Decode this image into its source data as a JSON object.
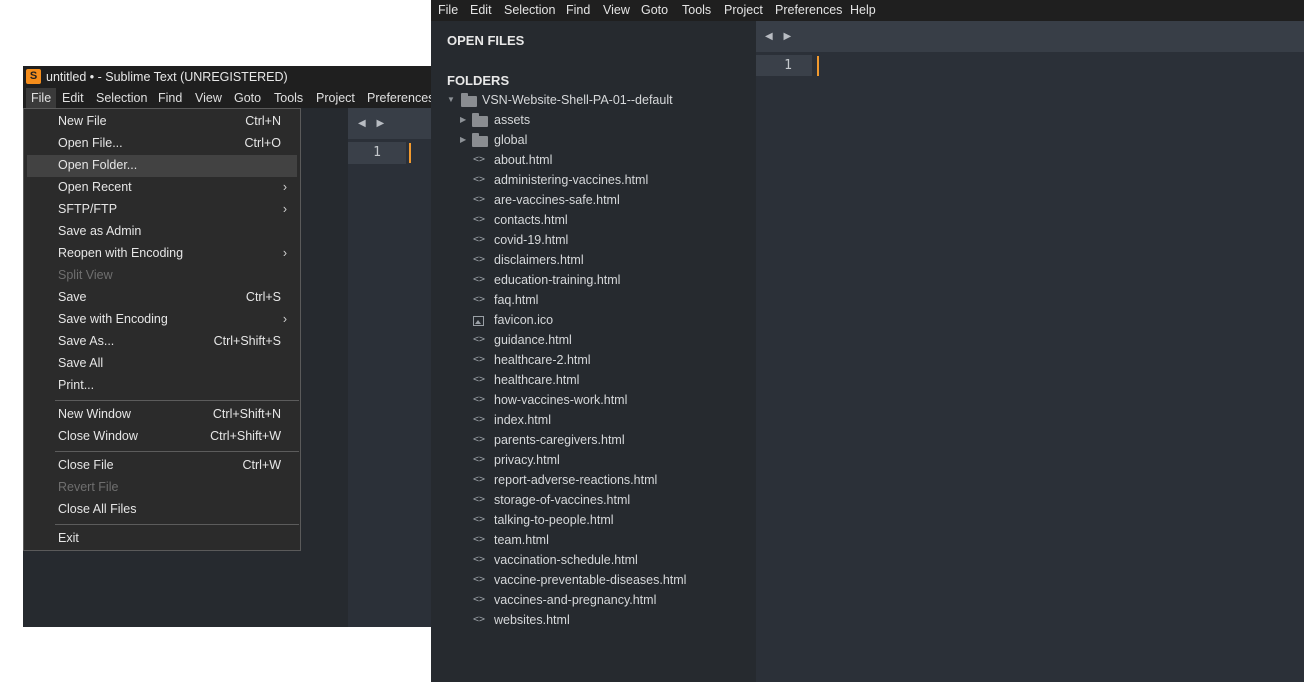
{
  "window1": {
    "title": "untitled • - Sublime Text (UNREGISTERED)",
    "logo": "S",
    "menu": [
      "File",
      "Edit",
      "Selection",
      "Find",
      "View",
      "Goto",
      "Tools",
      "Project",
      "Preferences"
    ],
    "line_number": "1"
  },
  "file_menu": {
    "items": [
      {
        "label": "New File",
        "shortcut": "Ctrl+N"
      },
      {
        "label": "Open File...",
        "shortcut": "Ctrl+O"
      },
      {
        "label": "Open Folder...",
        "shortcut": "",
        "highlighted": true
      },
      {
        "label": "Open Recent",
        "shortcut": "",
        "submenu": true
      },
      {
        "label": "SFTP/FTP",
        "shortcut": "",
        "submenu": true
      },
      {
        "label": "Save as Admin",
        "shortcut": ""
      },
      {
        "label": "Reopen with Encoding",
        "shortcut": "",
        "submenu": true
      },
      {
        "label": "Split View",
        "shortcut": "",
        "disabled": true
      },
      {
        "label": "Save",
        "shortcut": "Ctrl+S"
      },
      {
        "label": "Save with Encoding",
        "shortcut": "",
        "submenu": true
      },
      {
        "label": "Save As...",
        "shortcut": "Ctrl+Shift+S"
      },
      {
        "label": "Save All",
        "shortcut": ""
      },
      {
        "label": "Print...",
        "shortcut": ""
      },
      {
        "label": "New Window",
        "shortcut": "Ctrl+Shift+N"
      },
      {
        "label": "Close Window",
        "shortcut": "Ctrl+Shift+W"
      },
      {
        "label": "Close File",
        "shortcut": "Ctrl+W"
      },
      {
        "label": "Revert File",
        "shortcut": "",
        "disabled": true
      },
      {
        "label": "Close All Files",
        "shortcut": ""
      },
      {
        "label": "Exit",
        "shortcut": ""
      }
    ],
    "submenu_arrow": "›"
  },
  "window2": {
    "menu": [
      "File",
      "Edit",
      "Selection",
      "Find",
      "View",
      "Goto",
      "Tools",
      "Project",
      "Preferences",
      "Help"
    ],
    "sidebar": {
      "open_files_heading": "OPEN FILES",
      "folders_heading": "FOLDERS",
      "root_folder": "VSN-Website-Shell-PA-01--default",
      "subfolders": [
        "assets",
        "global"
      ],
      "files": [
        {
          "name": "about.html",
          "icon": "code-file-icon"
        },
        {
          "name": "administering-vaccines.html",
          "icon": "code-file-icon"
        },
        {
          "name": "are-vaccines-safe.html",
          "icon": "code-file-icon"
        },
        {
          "name": "contacts.html",
          "icon": "code-file-icon"
        },
        {
          "name": "covid-19.html",
          "icon": "code-file-icon"
        },
        {
          "name": "disclaimers.html",
          "icon": "code-file-icon"
        },
        {
          "name": "education-training.html",
          "icon": "code-file-icon"
        },
        {
          "name": "faq.html",
          "icon": "code-file-icon"
        },
        {
          "name": "favicon.ico",
          "icon": "image-file-icon"
        },
        {
          "name": "guidance.html",
          "icon": "code-file-icon"
        },
        {
          "name": "healthcare-2.html",
          "icon": "code-file-icon"
        },
        {
          "name": "healthcare.html",
          "icon": "code-file-icon"
        },
        {
          "name": "how-vaccines-work.html",
          "icon": "code-file-icon"
        },
        {
          "name": "index.html",
          "icon": "code-file-icon"
        },
        {
          "name": "parents-caregivers.html",
          "icon": "code-file-icon"
        },
        {
          "name": "privacy.html",
          "icon": "code-file-icon"
        },
        {
          "name": "report-adverse-reactions.html",
          "icon": "code-file-icon"
        },
        {
          "name": "storage-of-vaccines.html",
          "icon": "code-file-icon"
        },
        {
          "name": "talking-to-people.html",
          "icon": "code-file-icon"
        },
        {
          "name": "team.html",
          "icon": "code-file-icon"
        },
        {
          "name": "vaccination-schedule.html",
          "icon": "code-file-icon"
        },
        {
          "name": "vaccine-preventable-diseases.html",
          "icon": "code-file-icon"
        },
        {
          "name": "vaccines-and-pregnancy.html",
          "icon": "code-file-icon"
        },
        {
          "name": "websites.html",
          "icon": "code-file-icon"
        }
      ]
    },
    "line_number": "1"
  },
  "colors": {
    "accent_caret": "#f29a2e",
    "sidebar_bg": "#262a2f",
    "editor_bg": "#2b3038",
    "menu_bg": "#2b2b2b",
    "menu_highlight": "#424242"
  },
  "icons": {
    "nav_arrows": "◀ ▶",
    "code_file": "<>",
    "expanded": "▼",
    "collapsed": "▶"
  }
}
